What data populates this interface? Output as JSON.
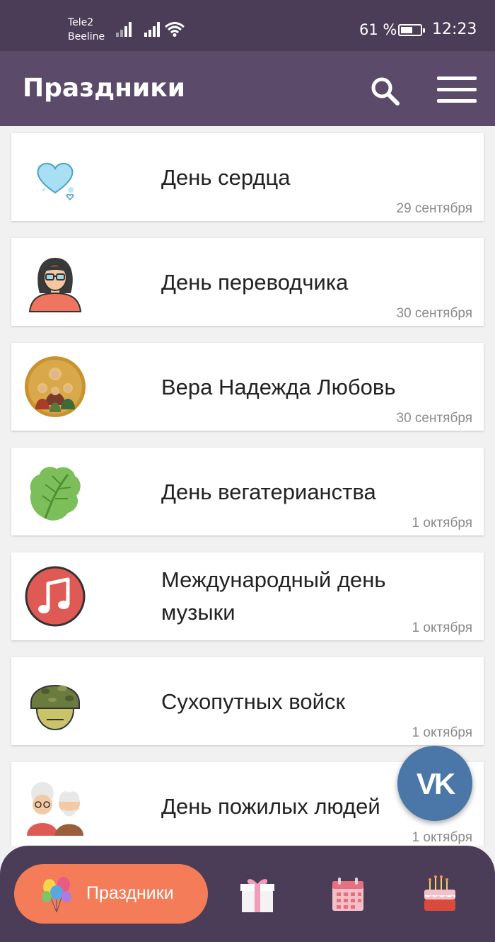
{
  "status_bar": {
    "carrier_1": "Tele2",
    "carrier_2": "Beeline",
    "battery_percent": "61 %",
    "battery_level": 0.61,
    "time": "12:23"
  },
  "app_bar": {
    "title": "Праздники",
    "search_icon": "search-icon",
    "menu_icon": "menu-icon"
  },
  "holidays": [
    {
      "name": "День сердца",
      "date": "29 сентября",
      "icon": "heart-icon"
    },
    {
      "name": "День переводчика",
      "date": "30 сентября",
      "icon": "woman-glasses-avatar-icon"
    },
    {
      "name": "Вера Надежда Любовь",
      "date": "30 сентября",
      "icon": "icon-saints-image"
    },
    {
      "name": "День вегатерианства",
      "date": "1 октября",
      "icon": "lettuce-icon"
    },
    {
      "name": "Международный день музыки",
      "date": "1 октября",
      "icon": "music-note-icon"
    },
    {
      "name": "Сухопутных войск",
      "date": "1 октября",
      "icon": "soldier-helmet-icon"
    },
    {
      "name": "День пожилых людей",
      "date": "1 октября",
      "icon": "elderly-couple-icon"
    }
  ],
  "fab": {
    "label": "VK",
    "icon": "vk-icon"
  },
  "bottom_nav": {
    "active_label": "Праздники",
    "items": [
      "balloons-icon",
      "gift-icon",
      "calendar-icon",
      "cake-icon"
    ]
  },
  "colors": {
    "status_bar": "#4b3d58",
    "app_bar": "#5b4a69",
    "accent": "#f47c59",
    "vk_blue": "#4a76a8"
  }
}
